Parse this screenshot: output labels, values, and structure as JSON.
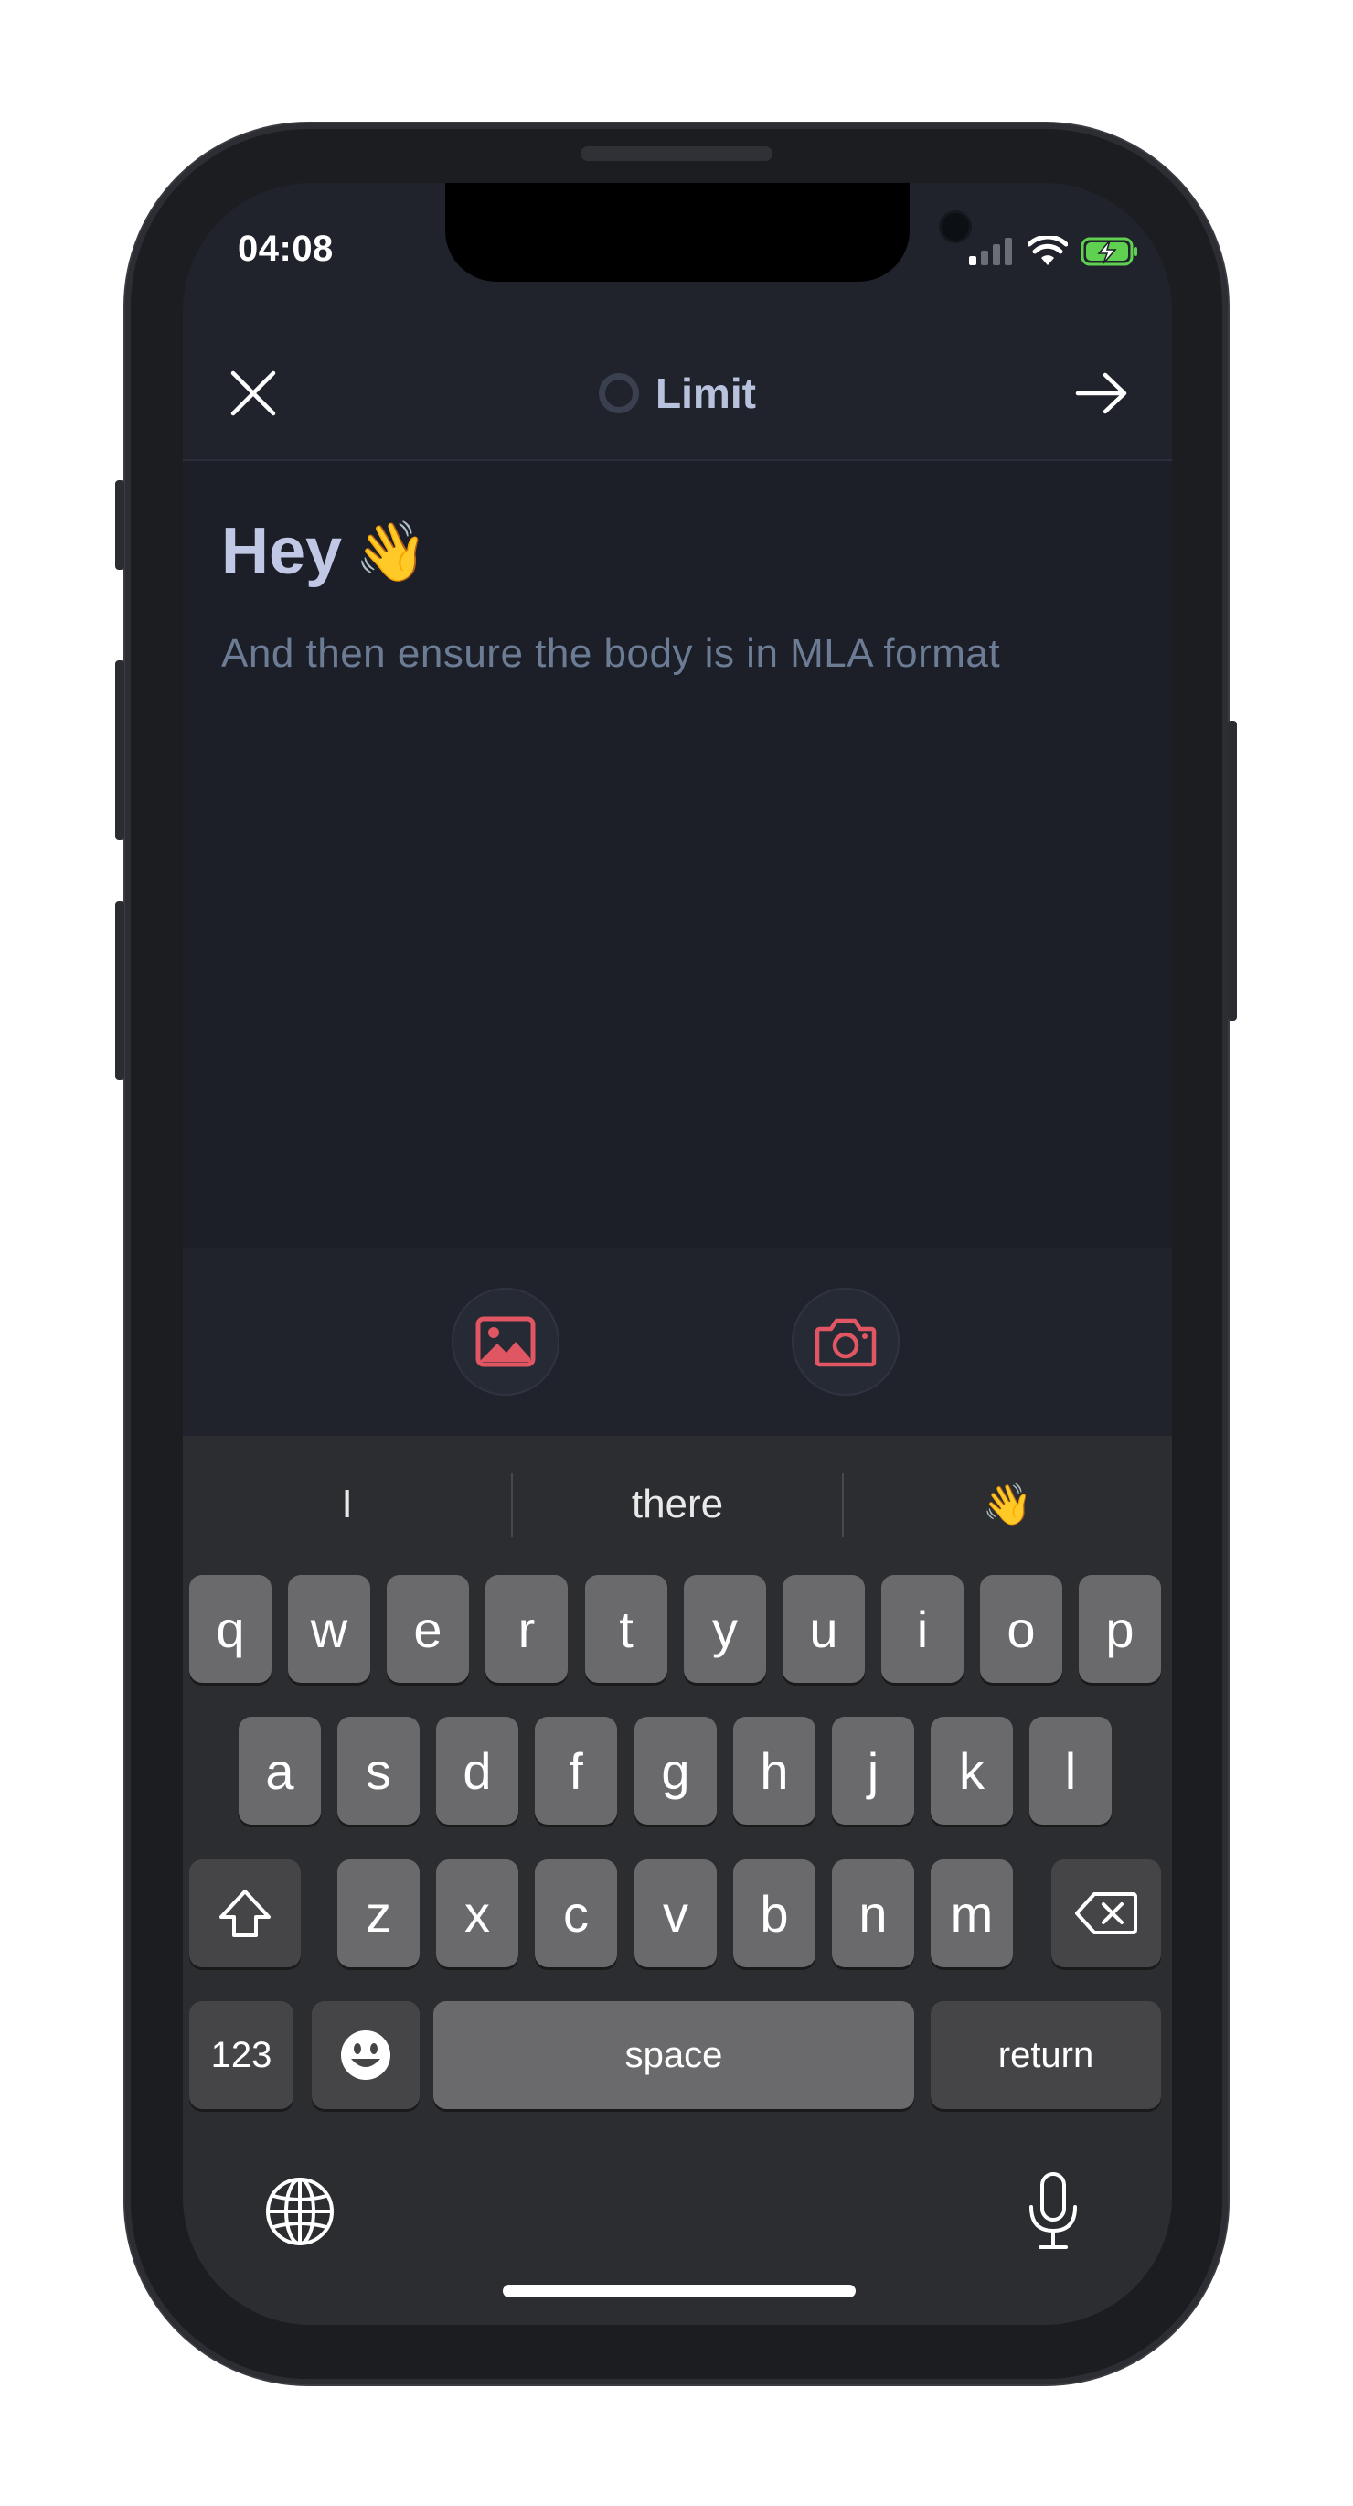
{
  "status_bar": {
    "time": "04:08"
  },
  "header": {
    "title": "Limit"
  },
  "composer": {
    "greeting": "Hey",
    "greeting_emoji": "👋",
    "body": "And then ensure the body is in MLA format"
  },
  "attachments": {
    "image_icon": "image-icon",
    "camera_icon": "camera-icon"
  },
  "keyboard": {
    "suggestions": [
      "I",
      "there",
      "👋"
    ],
    "row1": [
      "q",
      "w",
      "e",
      "r",
      "t",
      "y",
      "u",
      "i",
      "o",
      "p"
    ],
    "row2": [
      "a",
      "s",
      "d",
      "f",
      "g",
      "h",
      "j",
      "k",
      "l"
    ],
    "row3": [
      "z",
      "x",
      "c",
      "v",
      "b",
      "n",
      "m"
    ],
    "numbers_label": "123",
    "space_label": "space",
    "return_label": "return"
  },
  "colors": {
    "accent_red": "#e05763",
    "title": "#b9c2dc",
    "body_text": "#6c7c95"
  }
}
